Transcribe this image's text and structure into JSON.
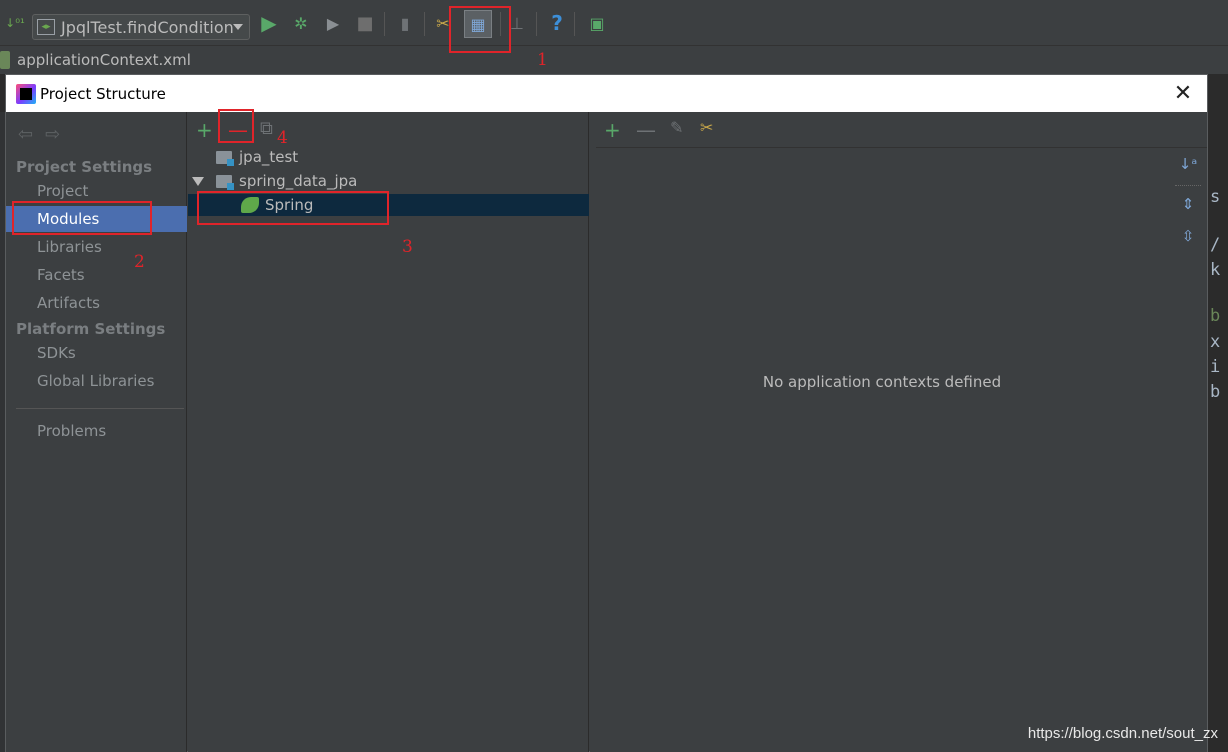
{
  "toolbar": {
    "run_config_label": "JpqlTest.findCondition",
    "icons": [
      "sort-icon",
      "run-icon",
      "debug-icon",
      "coverage-icon",
      "stop-icon",
      "build-icon",
      "project-structure-tools-icon",
      "project-structure-icon",
      "vcs-icon",
      "help-icon",
      "sdk-icon"
    ]
  },
  "breadcrumb": {
    "file": "applicationContext.xml"
  },
  "dialog": {
    "title": "Project Structure",
    "nav": {
      "section_project": "Project Settings",
      "items_project": [
        "Project",
        "Modules",
        "Libraries",
        "Facets",
        "Artifacts"
      ],
      "section_platform": "Platform Settings",
      "items_platform": [
        "SDKs",
        "Global Libraries"
      ],
      "problems": "Problems",
      "selected": "Modules"
    },
    "tree": {
      "items": [
        "jpa_test",
        "spring_data_jpa",
        "Spring"
      ],
      "selected": "Spring"
    },
    "right_panel": {
      "empty_message": "No application contexts defined"
    }
  },
  "annotations": [
    "1",
    "2",
    "3",
    "4"
  ],
  "watermark": "https://blog.csdn.net/sout_zx",
  "colors": {
    "accent": "#e0242a",
    "selection": "#4b6eaf",
    "spring_green": "#5fa84a"
  }
}
